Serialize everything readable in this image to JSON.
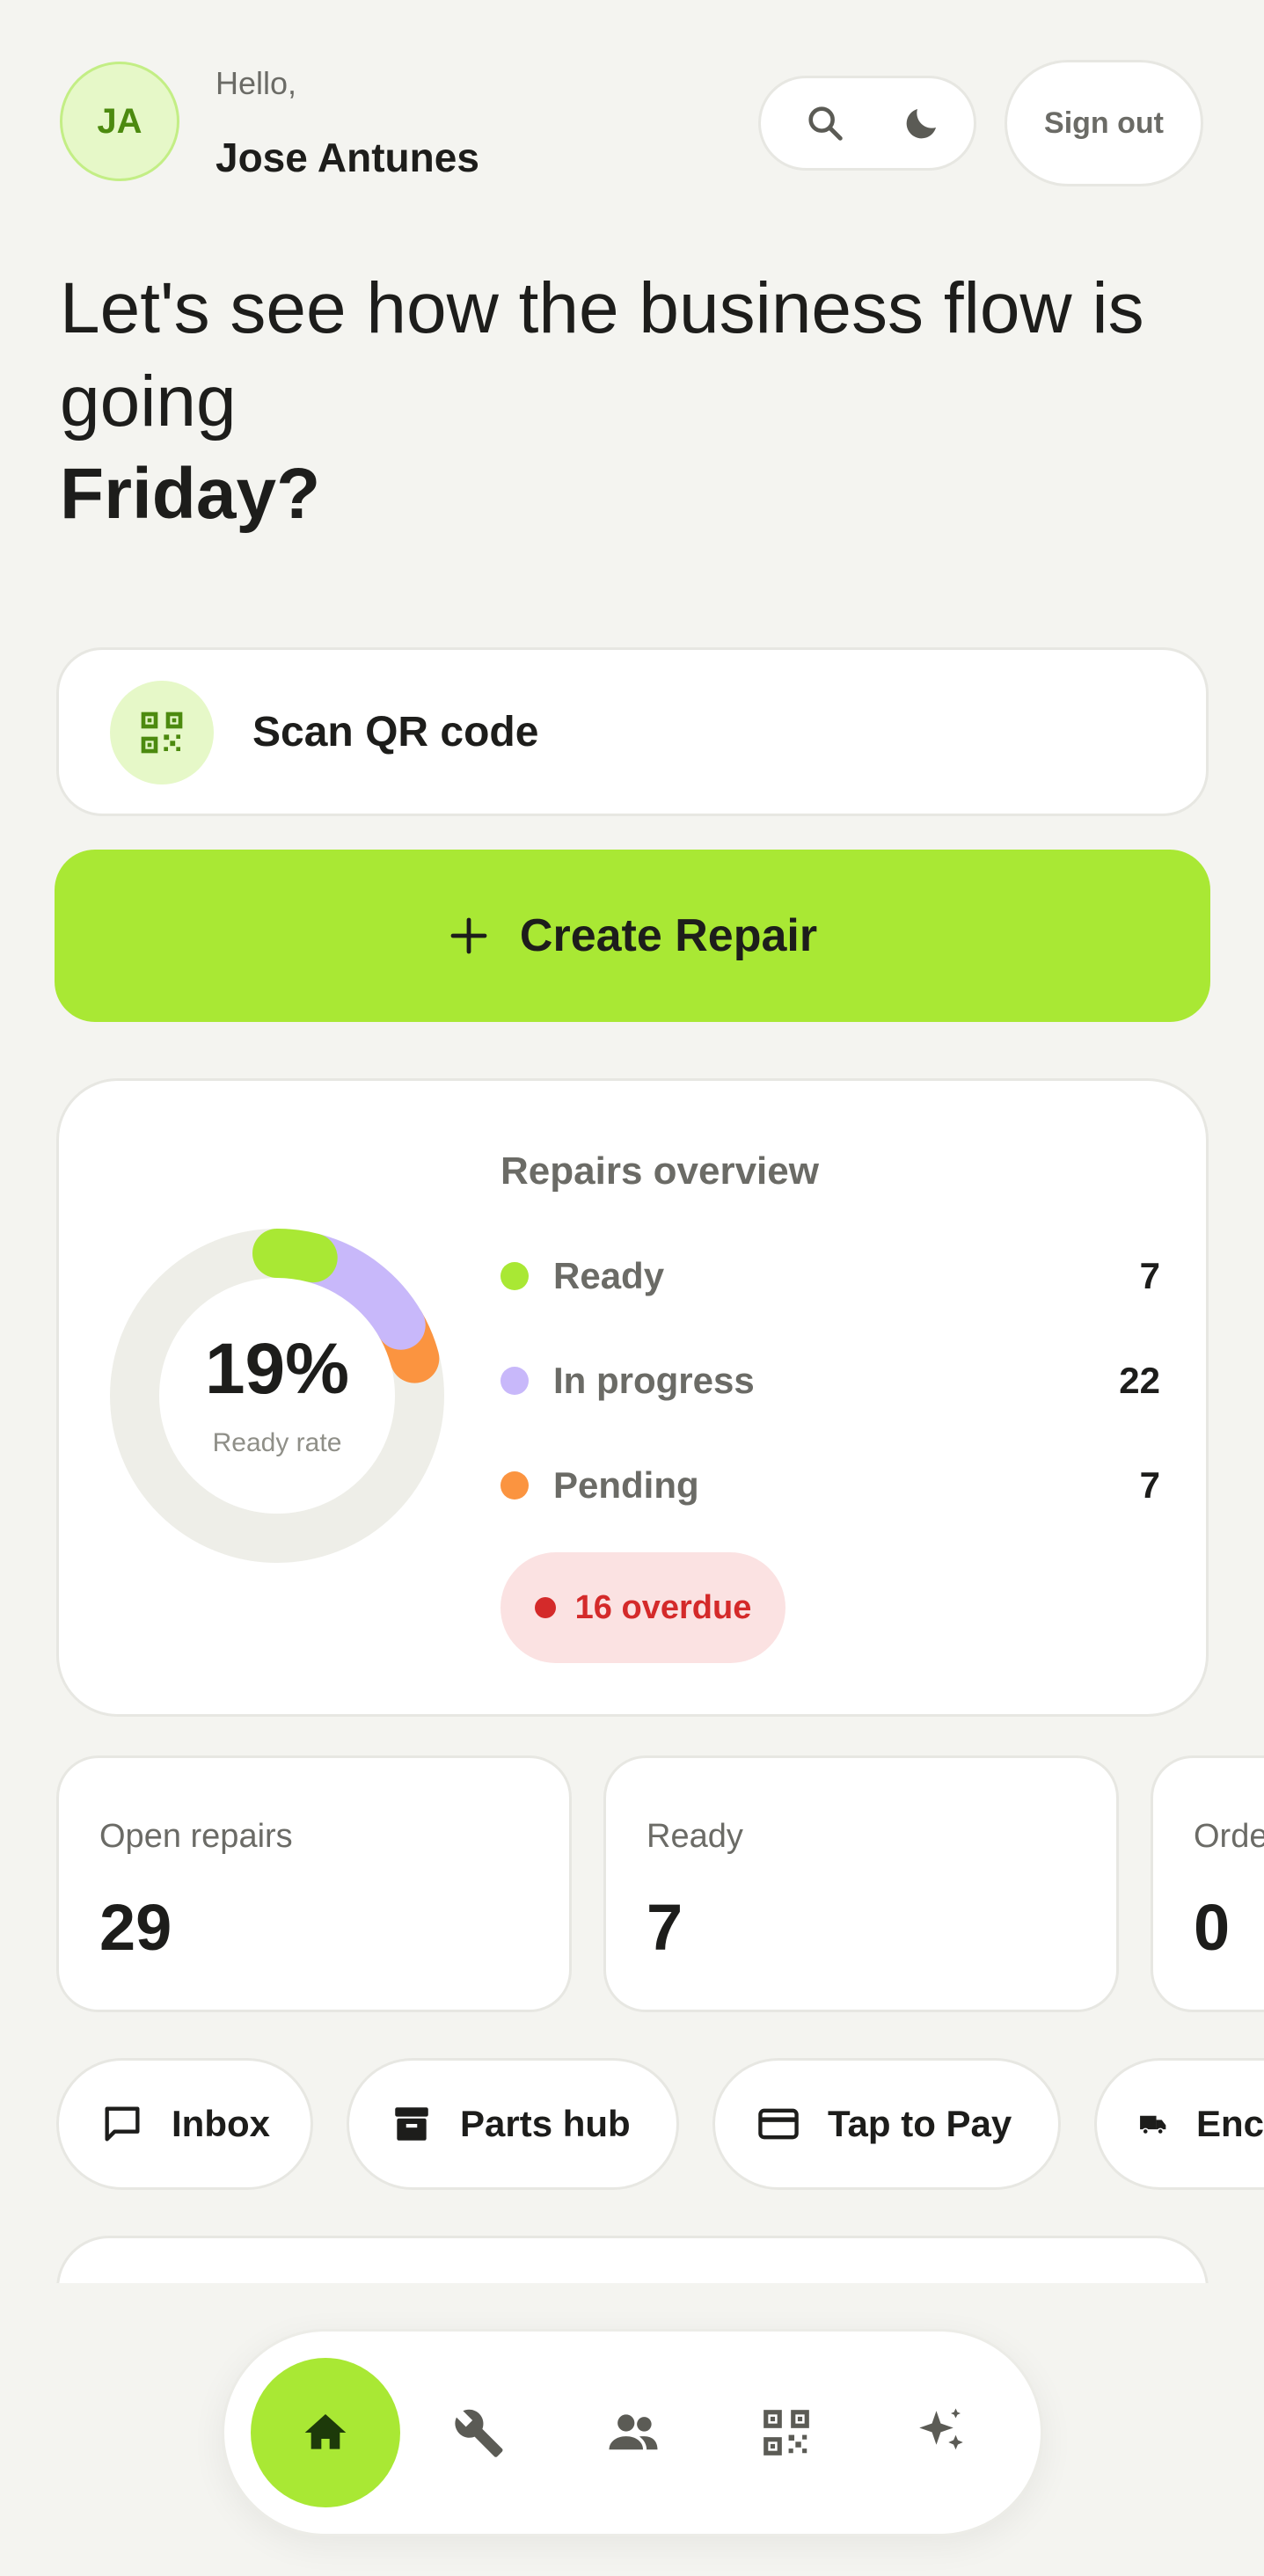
{
  "header": {
    "avatar_initials": "JA",
    "greeting": "Hello,",
    "user_name": "Jose Antunes",
    "search_icon": "search-icon",
    "theme_icon": "moon-icon",
    "sign_out_label": "Sign out"
  },
  "headline": {
    "line": "Let's see how the business flow is going",
    "day": "Friday?"
  },
  "scan": {
    "label": "Scan QR code",
    "icon": "qr-code-icon"
  },
  "create": {
    "label": "Create Repair",
    "icon": "plus-icon"
  },
  "overview": {
    "title": "Repairs overview",
    "ready_rate": "19%",
    "ready_rate_caption": "Ready rate",
    "items": [
      {
        "label": "Ready",
        "value": "7",
        "color": "#a9e834"
      },
      {
        "label": "In progress",
        "value": "22",
        "color": "#c8b8fa"
      },
      {
        "label": "Pending",
        "value": "7",
        "color": "#fb9440"
      }
    ],
    "overdue": "16 overdue",
    "chart_data": {
      "type": "pie",
      "categories": [
        "Ready",
        "In progress",
        "Pending"
      ],
      "values": [
        7,
        22,
        7
      ],
      "colors": [
        "#a9e834",
        "#c8b8fa",
        "#fb9440"
      ]
    }
  },
  "stats": [
    {
      "label": "Open repairs",
      "value": "29"
    },
    {
      "label": "Ready",
      "value": "7"
    },
    {
      "label": "Orde",
      "value": "0"
    }
  ],
  "quick_actions": [
    {
      "label": "Inbox",
      "icon": "chat-icon"
    },
    {
      "label": "Parts hub",
      "icon": "archive-icon"
    },
    {
      "label": "Tap to Pay",
      "icon": "credit-card-icon"
    },
    {
      "label": "Enc",
      "icon": "truck-icon"
    }
  ],
  "nav": [
    {
      "icon": "home-icon",
      "active": true
    },
    {
      "icon": "wrench-icon",
      "active": false
    },
    {
      "icon": "people-icon",
      "active": false
    },
    {
      "icon": "qr-code-icon",
      "active": false
    },
    {
      "icon": "sparkle-icon",
      "active": false
    }
  ],
  "colors": {
    "accent": "#a9e834",
    "background": "#f4f4f0",
    "danger": "#d42a2a"
  }
}
